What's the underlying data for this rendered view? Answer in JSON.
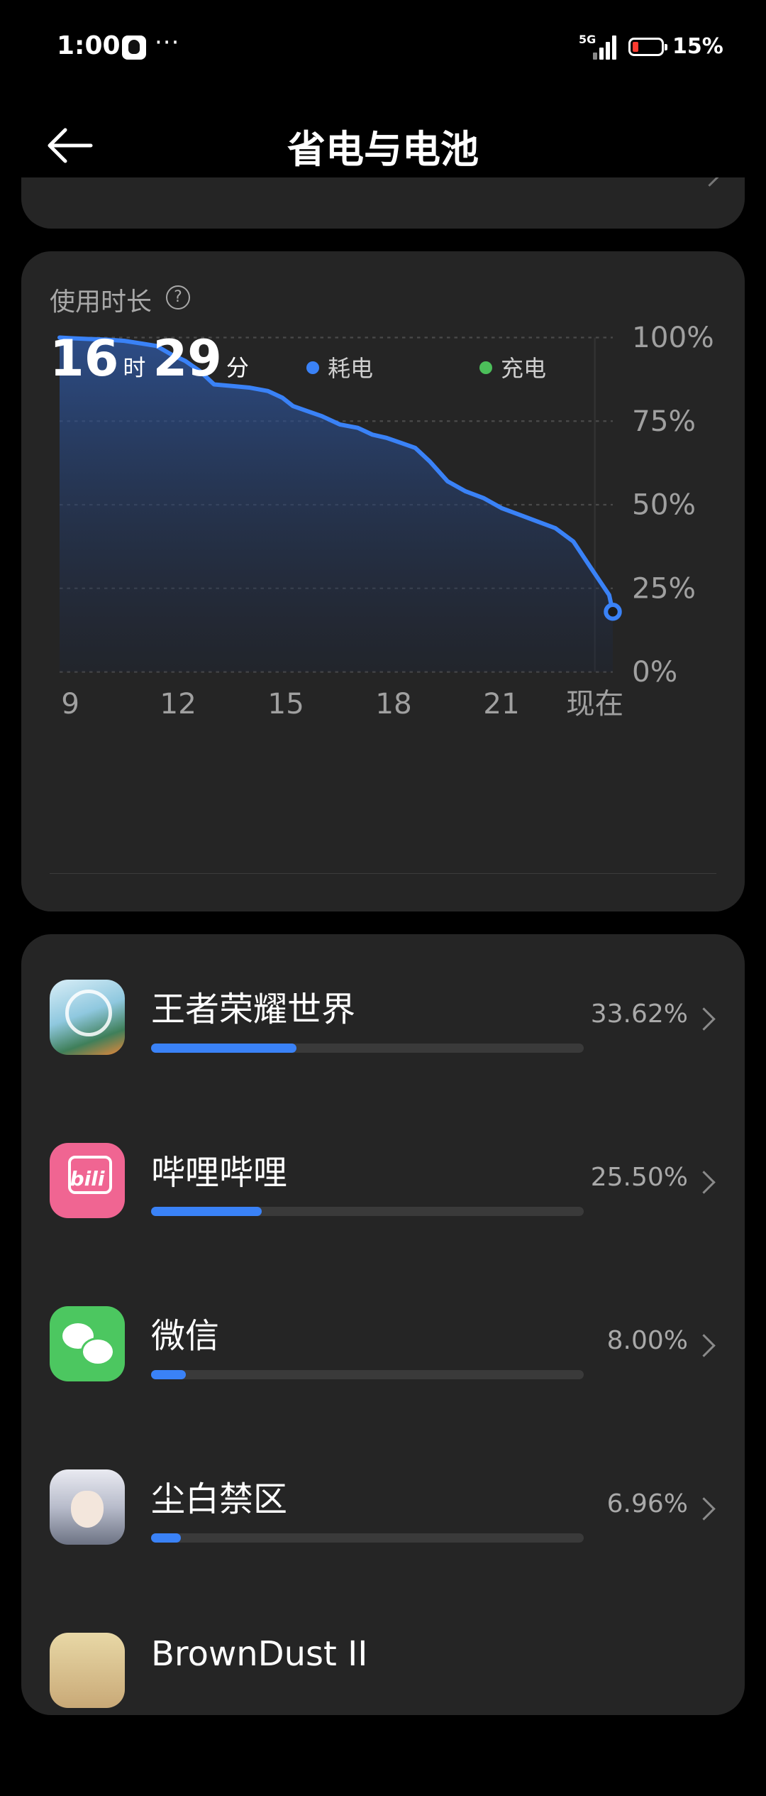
{
  "status_bar": {
    "time": "1:00",
    "dots": "···",
    "network": "5G",
    "battery": "15%"
  },
  "header": {
    "title": "省电与电池"
  },
  "usage": {
    "label": "使用时长",
    "hours": "16",
    "hours_unit": "时",
    "minutes": "29",
    "minutes_unit": "分",
    "legend": [
      {
        "label": "耗电",
        "color": "#3a82f7"
      },
      {
        "label": "充电",
        "color": "#4cbf5a"
      }
    ]
  },
  "chart_data": {
    "type": "area",
    "x": [
      8.7,
      9,
      9.5,
      10,
      10.5,
      11,
      11.4,
      11.8,
      12.2,
      12.6,
      13,
      13.5,
      14,
      14.5,
      14.9,
      15.2,
      15.6,
      16,
      16.5,
      17,
      17.4,
      17.8,
      18.2,
      18.6,
      19,
      19.5,
      20,
      20.5,
      21,
      21.5,
      22,
      22.5,
      23,
      23.5,
      24,
      24.1
    ],
    "y": [
      100,
      99.8,
      99.6,
      99.4,
      99,
      98.2,
      97.5,
      95,
      93,
      90,
      86,
      85.5,
      85,
      84,
      82,
      79.5,
      78,
      76.5,
      74,
      73,
      71,
      70,
      68.5,
      67,
      63,
      57,
      54,
      52,
      49,
      47,
      45,
      43,
      39,
      31,
      23,
      18
    ],
    "x_ticks": [
      "9",
      "12",
      "15",
      "18",
      "21",
      "现在"
    ],
    "y_ticks": [
      "100%",
      "75%",
      "50%",
      "25%",
      "0%"
    ],
    "xlim": [
      8.7,
      24.1
    ],
    "ylim": [
      0,
      100
    ],
    "grid": true,
    "series_color": "#3a82f7"
  },
  "apps": [
    {
      "name": "王者荣耀世界",
      "percent": "33.62%",
      "fraction": 0.3362,
      "icon": "game-icon"
    },
    {
      "name": "哔哩哔哩",
      "percent": "25.50%",
      "fraction": 0.255,
      "icon": "bilibili-icon"
    },
    {
      "name": "微信",
      "percent": "8.00%",
      "fraction": 0.08,
      "icon": "wechat-icon"
    },
    {
      "name": "尘白禁区",
      "percent": "6.96%",
      "fraction": 0.0696,
      "icon": "game-character-icon"
    },
    {
      "name": "BrownDust II",
      "icon": "game-character-icon"
    }
  ]
}
